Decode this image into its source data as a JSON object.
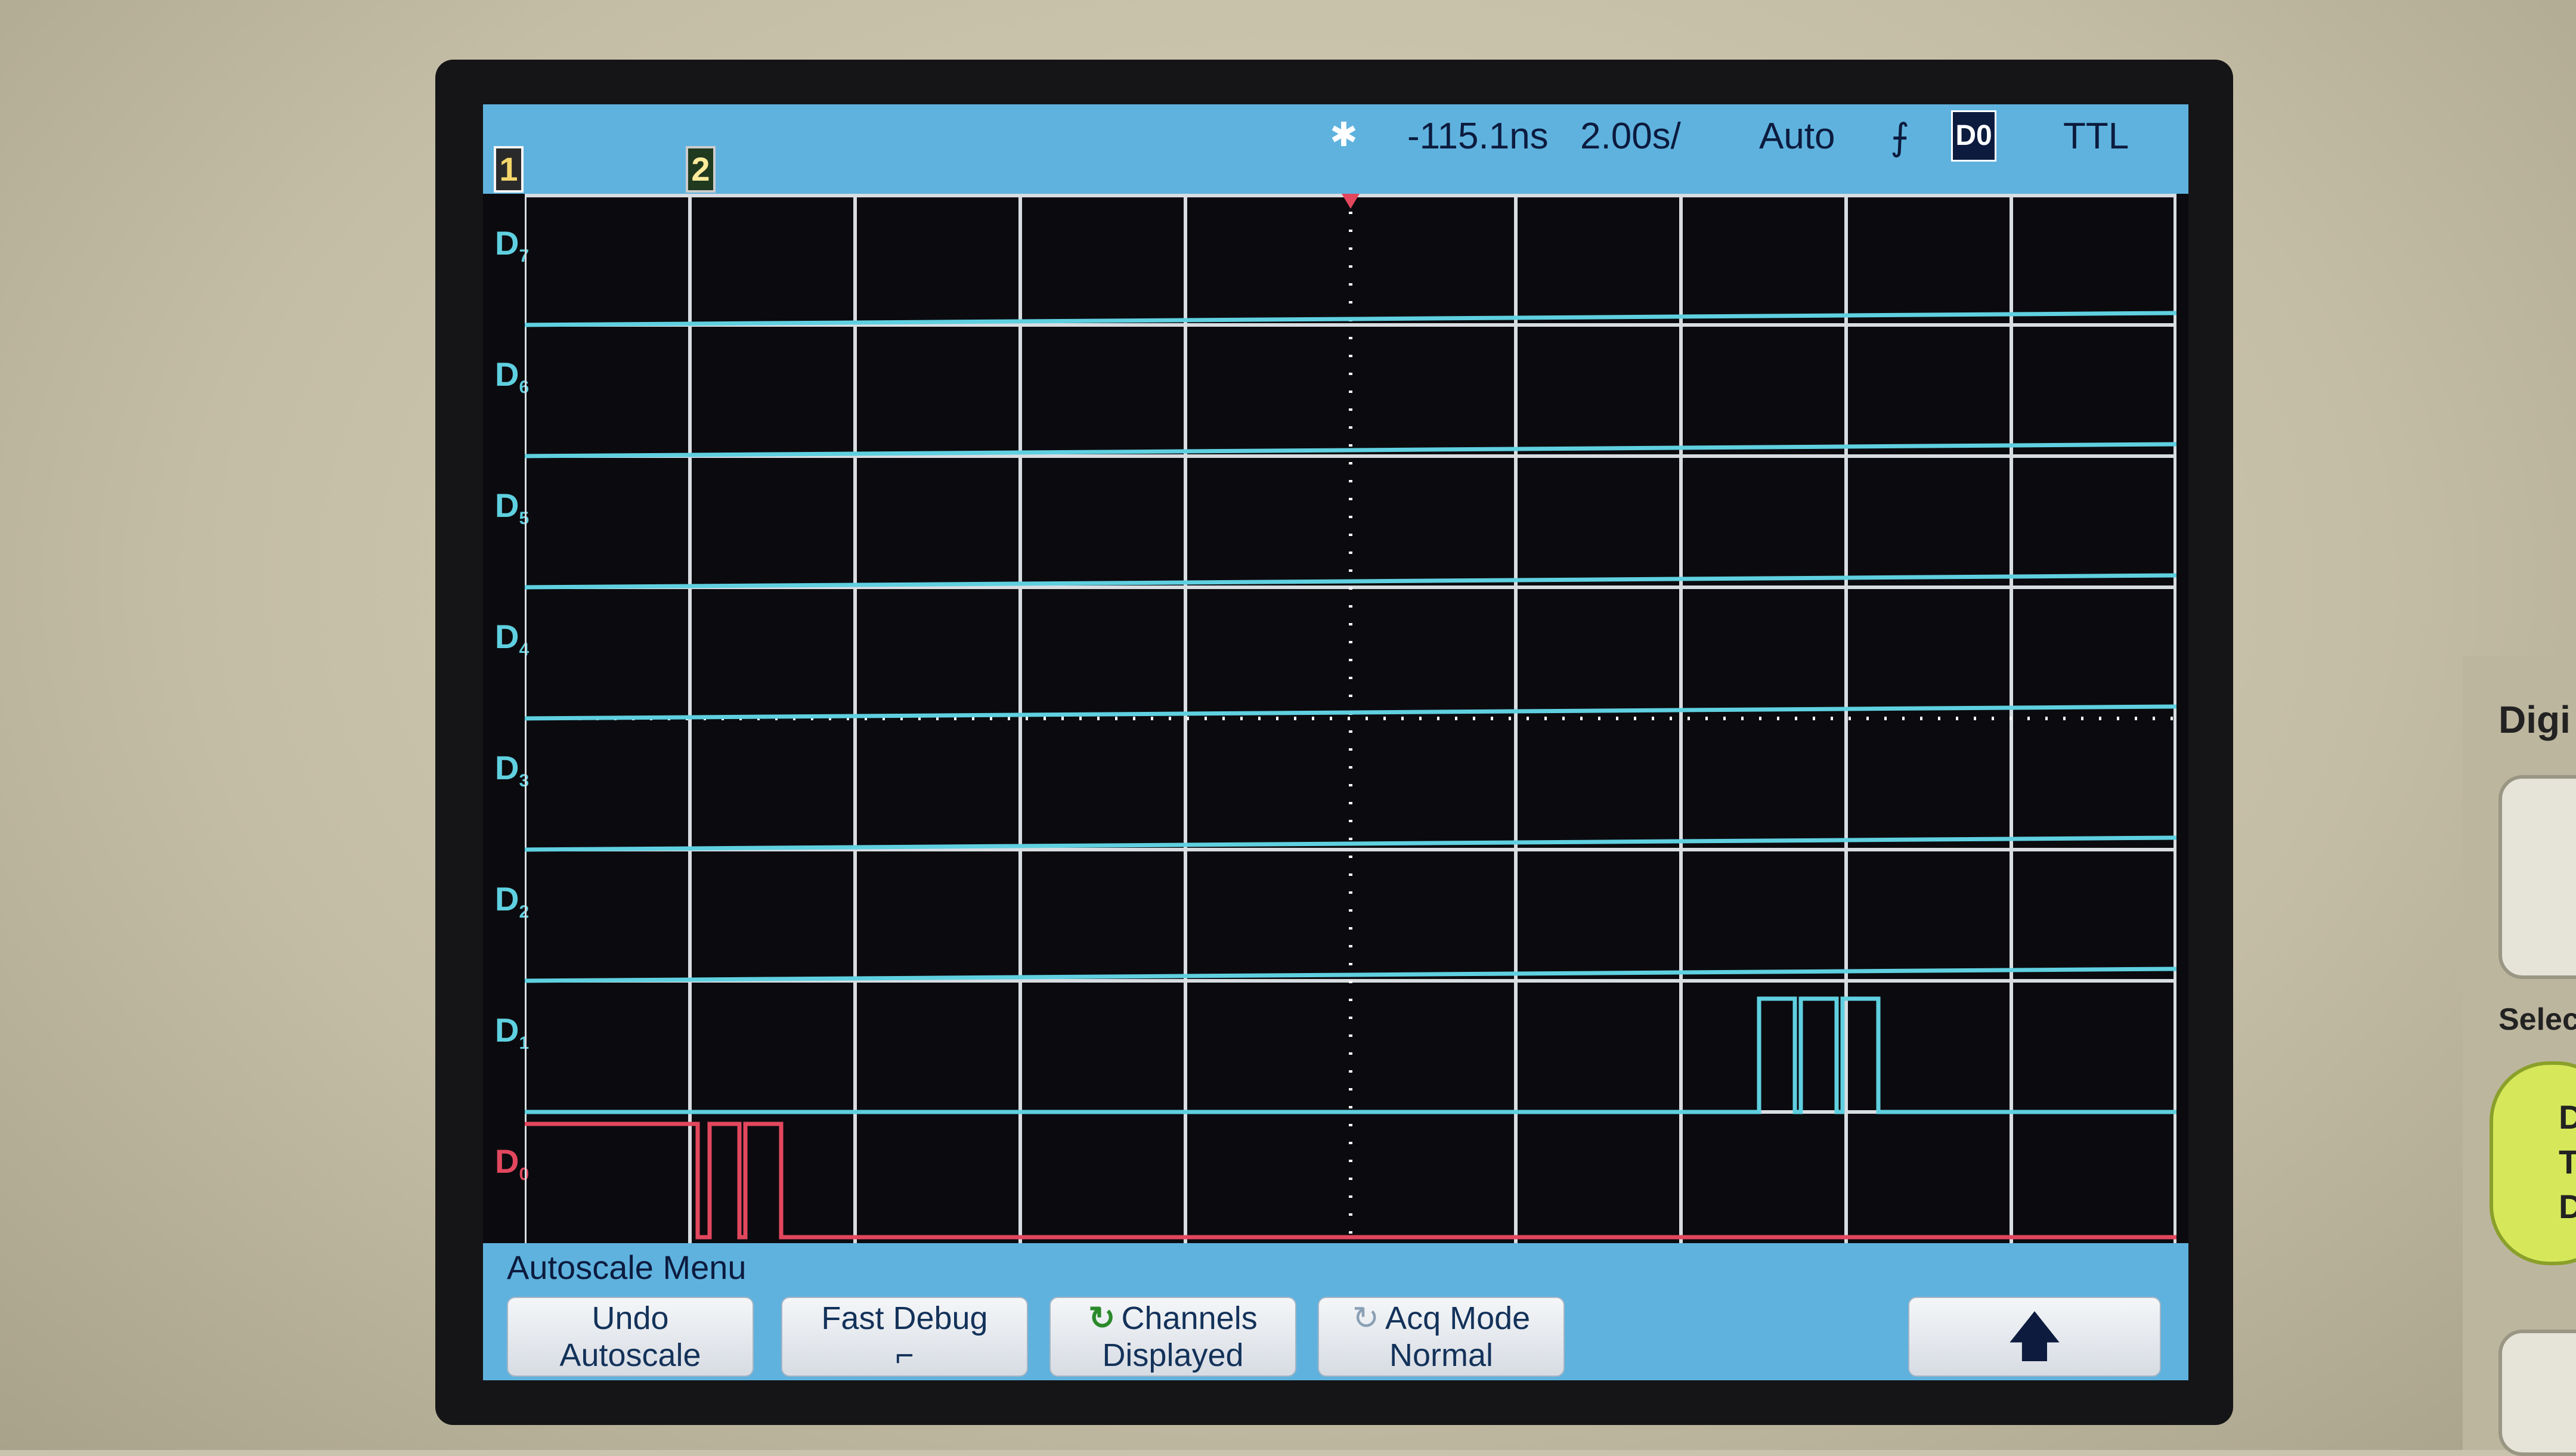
{
  "topbar": {
    "ch1": "1",
    "ch2": "2",
    "delay": "-115.1ns",
    "timebase": "2.00s/",
    "trigger_mode": "Auto",
    "trigger_slope": "⨍",
    "trigger_source": "D0",
    "threshold": "TTL"
  },
  "channels": [
    {
      "label": "D",
      "sub": "7"
    },
    {
      "label": "D",
      "sub": "6"
    },
    {
      "label": "D",
      "sub": "5"
    },
    {
      "label": "D",
      "sub": "4"
    },
    {
      "label": "D",
      "sub": "3"
    },
    {
      "label": "D",
      "sub": "2"
    },
    {
      "label": "D",
      "sub": "1"
    },
    {
      "label": "D",
      "sub": "0"
    }
  ],
  "menu": {
    "title": "Autoscale Menu",
    "keys": [
      {
        "line1": "Undo",
        "line2": "Autoscale"
      },
      {
        "line1": "Fast Debug",
        "line2": "⌐"
      },
      {
        "line1": "Channels",
        "line2": "Displayed",
        "icon": "↻"
      },
      {
        "line1": "Acq Mode",
        "line2": "Normal",
        "icon": "↻"
      },
      {
        "line1": "🡅"
      }
    ]
  },
  "panel": {
    "digital_label": "Digi",
    "select_label": "Selec",
    "green_lines": [
      "D",
      "T",
      "D"
    ]
  },
  "colors": {
    "trace_digital": "#5fd0e0",
    "trace_d0": "#e2475e",
    "grid": "#d8dde2",
    "bar": "#5fb2de"
  }
}
